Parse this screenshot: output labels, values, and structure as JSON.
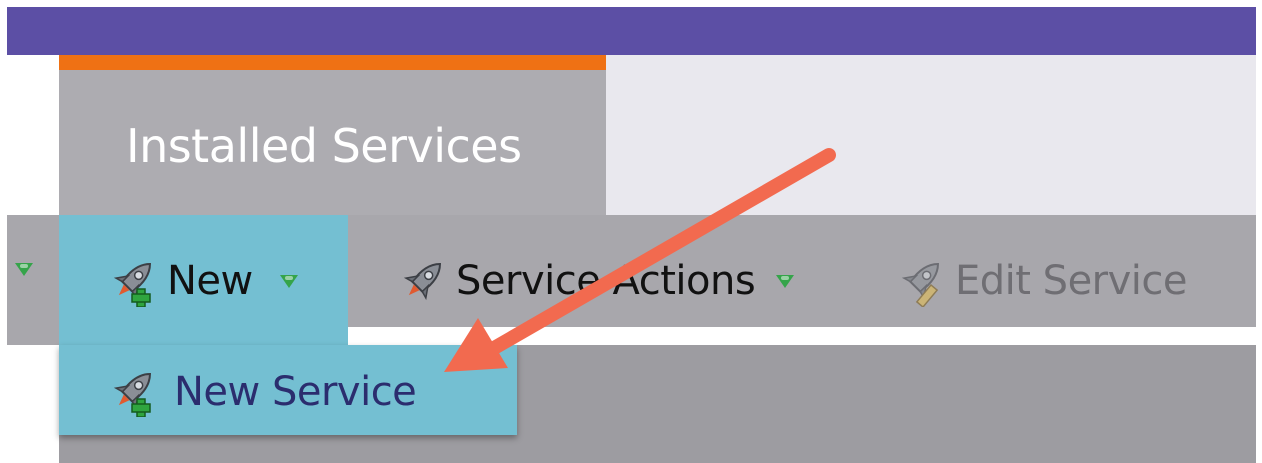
{
  "tabs": {
    "active_label": "Installed Services"
  },
  "toolbar": {
    "new_label": "New",
    "service_actions_label": "Service Actions",
    "edit_service_label": "Edit Service"
  },
  "new_menu": {
    "items": [
      {
        "label": "New Service"
      }
    ]
  },
  "icons": {
    "rocket": "rocket-icon",
    "add_overlay": "plus-icon",
    "edit_overlay": "pencil-icon",
    "dropdown": "triangle-down-icon"
  },
  "colors": {
    "header": "#5c4fa5",
    "tab_accent": "#ef7114",
    "highlight": "#74bfd2",
    "dropdown_triangle": "#35a44a",
    "annotation_arrow": "#f26a4f"
  }
}
